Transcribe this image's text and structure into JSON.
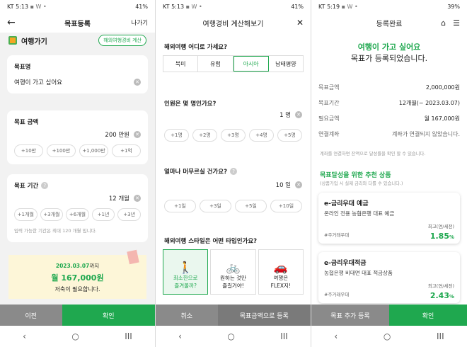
{
  "status": {
    "carrier": "KT",
    "p1_time": "5:13",
    "p2_time": "5:13",
    "p3_time": "5:19",
    "p1_battery": "41%",
    "p2_battery": "41%",
    "p3_battery": "39%",
    "extra_icons": "▪ W •"
  },
  "nav": {
    "back": "‹",
    "home": "○",
    "recent": "III"
  },
  "p1": {
    "title": "목표등록",
    "exit": "나가기",
    "category": "여행가기",
    "calc_btn": "해외여행경비 계산",
    "name_label": "목표명",
    "name_value": "여행이 가고 싶어요",
    "amount_label": "목표 금액",
    "amount_value": "200 만원",
    "amount_chips": [
      "+10만",
      "+100만",
      "+1,000만",
      "+1억"
    ],
    "period_label": "목표 기간",
    "period_value": "12 개월",
    "period_chips": [
      "+1개월",
      "+3개월",
      "+6개월",
      "+1년",
      "+3년"
    ],
    "period_note": "입력 가능한 기간은 최대 120 개월 입니다.",
    "summary_date": "2023.03.07",
    "summary_until": "까지",
    "summary_amount": "월 167,000원",
    "summary_need": "저축이 필요합니다.",
    "prev": "이전",
    "confirm": "확인"
  },
  "p2": {
    "title": "여행경비 계산해보기",
    "close": "✕",
    "q_where": "해외여행 어디로 가세요?",
    "regions": [
      "북미",
      "유럽",
      "아시아",
      "남태평양"
    ],
    "q_people": "인원은 몇 명인가요?",
    "people_value": "1 명",
    "people_chips": [
      "+1명",
      "+2명",
      "+3명",
      "+4명",
      "+5명"
    ],
    "q_stay": "얼마나 머무르실 건가요?",
    "stay_value": "10 일",
    "stay_chips": [
      "+1일",
      "+3일",
      "+5일",
      "+10일"
    ],
    "q_style": "해외여행 스타일은 어떤 타입인가요?",
    "styles": [
      {
        "line1": "최소한으로",
        "line2": "즐겨볼까?"
      },
      {
        "line1": "원하는 것만",
        "line2": "즐길거야!"
      },
      {
        "line1": "여행은",
        "line2": "FLEX지!"
      }
    ],
    "cancel": "취소",
    "register": "목표금액으로 등록"
  },
  "p3": {
    "title": "등록완료",
    "headline": "여행이 가고 싶어요",
    "subline": "목표가 등록되었습니다.",
    "rows": [
      {
        "k": "목표금액",
        "v": "2,000,000원"
      },
      {
        "k": "목표기간",
        "v": "12개월(~ 2023.03.07)"
      },
      {
        "k": "필요금액",
        "v": "월 167,000원"
      },
      {
        "k": "연결계좌",
        "v": "계좌가 연결되지 않았습니다."
      }
    ],
    "link_note": "계좌를 연결하면 잔액으로 달성률을 확인 할 수 있습니다.",
    "rec_title": "목표달성을 위한 추천 상품",
    "rec_note": "(상품가입 시 실제 금리와 다를 수 있습니다.)",
    "products": [
      {
        "name": "e-금리우대 예금",
        "desc": "온라인 전용 농협은행 대표 예금",
        "tag": "#주거래우대",
        "rate_label": "최고(연/세전)",
        "rate": "1.85",
        "unit": "%"
      },
      {
        "name": "e-금리우대적금",
        "desc": "농협은행 비대면 대표 적금상품",
        "tag": "#주거래우대",
        "rate_label": "최고(연/세전)",
        "rate": "2.43",
        "unit": "%"
      }
    ],
    "add_goal": "목표 추가 등록",
    "confirm": "확인"
  }
}
